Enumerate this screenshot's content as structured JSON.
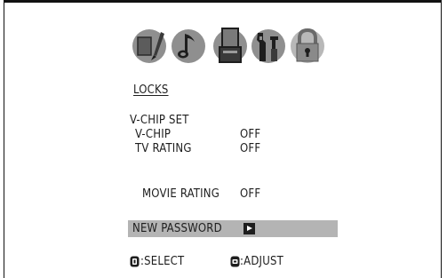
{
  "menu": {
    "title": "LOCKS",
    "tab_icons": [
      "picture-icon",
      "audio-icon",
      "setup-icon",
      "tools-icon",
      "lock-icon"
    ]
  },
  "vchip_set": {
    "header": "V-CHIP SET",
    "vchip": {
      "label": "V-CHIP",
      "value": "OFF"
    },
    "tv_rating": {
      "label": "TV RATING",
      "value": "OFF"
    },
    "movie_rating": {
      "label": "MOVIE RATING",
      "value": "OFF"
    }
  },
  "new_password": {
    "label": "NEW PASSWORD"
  },
  "footer": {
    "select_label": ":SELECT",
    "adjust_label": ":ADJUST"
  },
  "colors": {
    "highlight": "#b4b4b4",
    "text": "#1e1e1e",
    "icon_inactive": "#909090"
  }
}
